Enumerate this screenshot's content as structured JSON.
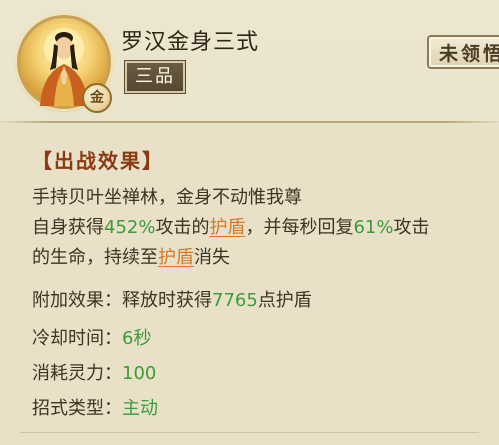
{
  "skill": {
    "name": "罗汉金身三式",
    "rank": "三品",
    "grade_badge": "金",
    "status_button": "未领悟"
  },
  "effect": {
    "section_title": "【出战效果】",
    "line1": "手持贝叶坐禅林，金身不动惟我尊",
    "line2_a": "自身获得",
    "line2_pct": "452%",
    "line2_b": "攻击的",
    "line2_link": "护盾",
    "line2_c": "，并每秒回复",
    "line2_pct2": "61%",
    "line2_d": "攻击",
    "line3_a": "的生命，持续至",
    "line3_link": "护盾",
    "line3_b": "消失"
  },
  "extra": {
    "label": "附加效果：",
    "text_a": "释放时获得",
    "value": "7765",
    "text_b": "点护盾"
  },
  "cooldown": {
    "label": "冷却时间：",
    "value": "6秒"
  },
  "cost": {
    "label": "消耗灵力：",
    "value": "100"
  },
  "type": {
    "label": "招式类型：",
    "value": "主动"
  },
  "colors": {
    "value_green": "#3f9a3a",
    "link_orange": "#d47a2a",
    "title_red": "#8a3b14"
  }
}
